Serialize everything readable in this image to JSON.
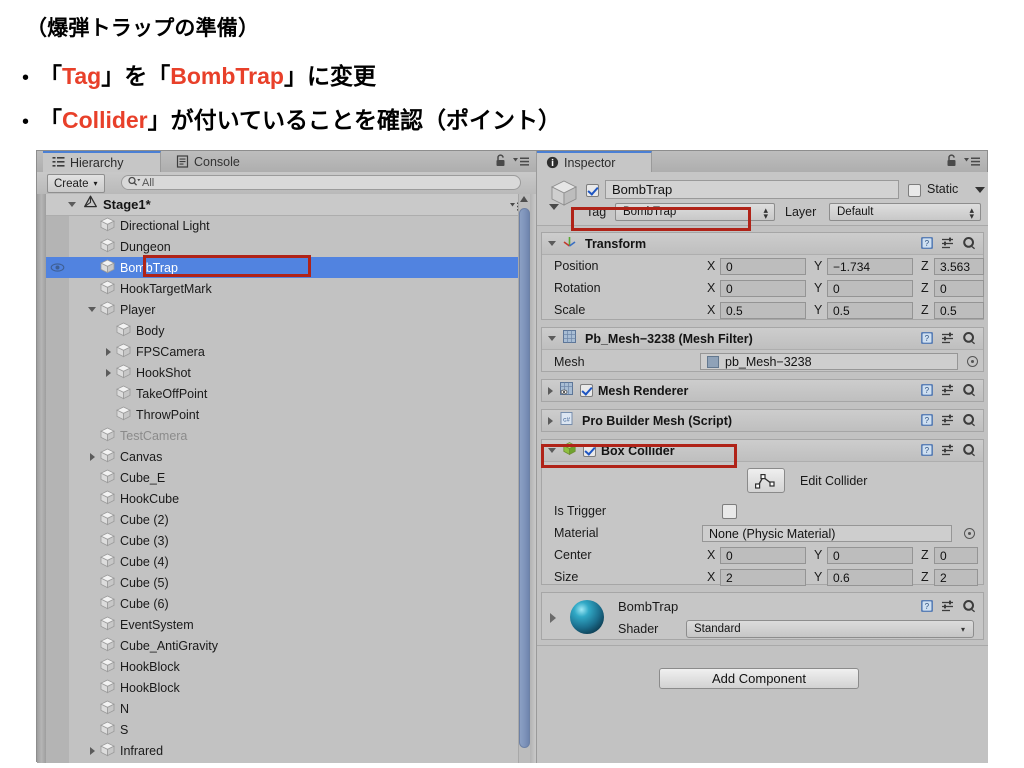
{
  "slide": {
    "title": "（爆弾トラップの準備）",
    "bullets": [
      {
        "dot": "•",
        "pre": "「",
        "em1": "Tag",
        "mid": "」を「",
        "em2": "BombTrap",
        "post": "」に変更"
      },
      {
        "dot": "•",
        "pre": "「",
        "em1": "Collider",
        "mid": "」が付いていることを確認（ポイント）",
        "em2": "",
        "post": ""
      }
    ],
    "bullet1_parts": [
      "「",
      "Tag",
      "」を「",
      "BombTrap",
      "」に変更"
    ],
    "bullet2_parts": [
      "「",
      "Collider",
      "」が付いていることを確認（ポイント）"
    ]
  },
  "hierarchy": {
    "tabs": [
      {
        "label": "Hierarchy",
        "icon": "hierarchy-list-icon",
        "active": true
      },
      {
        "label": "Console",
        "icon": "console-icon",
        "active": false
      }
    ],
    "lock_icon": "lock-icon",
    "menu_icon": "panel-menu-icon",
    "toolbar": {
      "create_label": "Create",
      "create_arrow": "▾",
      "search_value": "All",
      "search_icon": "search-icon"
    },
    "scene": {
      "name": "Stage1*",
      "icon": "unity-scene-icon",
      "expanded": true,
      "menu_icon": "scene-menu-icon"
    },
    "items": [
      {
        "label": "Directional Light",
        "depth": 1,
        "twisty": "none",
        "selected": false,
        "dim": false,
        "eye": false
      },
      {
        "label": "Dungeon",
        "depth": 1,
        "twisty": "none",
        "selected": false,
        "dim": false,
        "eye": false
      },
      {
        "label": "BombTrap",
        "depth": 1,
        "twisty": "none",
        "selected": true,
        "dim": false,
        "eye": true
      },
      {
        "label": "HookTargetMark",
        "depth": 1,
        "twisty": "none",
        "selected": false,
        "dim": false,
        "eye": false
      },
      {
        "label": "Player",
        "depth": 1,
        "twisty": "down",
        "selected": false,
        "dim": false,
        "eye": false
      },
      {
        "label": "Body",
        "depth": 2,
        "twisty": "none",
        "selected": false,
        "dim": false,
        "eye": false
      },
      {
        "label": "FPSCamera",
        "depth": 2,
        "twisty": "right",
        "selected": false,
        "dim": false,
        "eye": false
      },
      {
        "label": "HookShot",
        "depth": 2,
        "twisty": "right",
        "selected": false,
        "dim": false,
        "eye": false
      },
      {
        "label": "TakeOffPoint",
        "depth": 2,
        "twisty": "none",
        "selected": false,
        "dim": false,
        "eye": false
      },
      {
        "label": "ThrowPoint",
        "depth": 2,
        "twisty": "none",
        "selected": false,
        "dim": false,
        "eye": false
      },
      {
        "label": "TestCamera",
        "depth": 1,
        "twisty": "none",
        "selected": false,
        "dim": true,
        "eye": false
      },
      {
        "label": "Canvas",
        "depth": 1,
        "twisty": "right",
        "selected": false,
        "dim": false,
        "eye": false
      },
      {
        "label": "Cube_E",
        "depth": 1,
        "twisty": "none",
        "selected": false,
        "dim": false,
        "eye": false
      },
      {
        "label": "HookCube",
        "depth": 1,
        "twisty": "none",
        "selected": false,
        "dim": false,
        "eye": false
      },
      {
        "label": "Cube (2)",
        "depth": 1,
        "twisty": "none",
        "selected": false,
        "dim": false,
        "eye": false
      },
      {
        "label": "Cube (3)",
        "depth": 1,
        "twisty": "none",
        "selected": false,
        "dim": false,
        "eye": false
      },
      {
        "label": "Cube (4)",
        "depth": 1,
        "twisty": "none",
        "selected": false,
        "dim": false,
        "eye": false
      },
      {
        "label": "Cube (5)",
        "depth": 1,
        "twisty": "none",
        "selected": false,
        "dim": false,
        "eye": false
      },
      {
        "label": "Cube (6)",
        "depth": 1,
        "twisty": "none",
        "selected": false,
        "dim": false,
        "eye": false
      },
      {
        "label": "EventSystem",
        "depth": 1,
        "twisty": "none",
        "selected": false,
        "dim": false,
        "eye": false
      },
      {
        "label": "Cube_AntiGravity",
        "depth": 1,
        "twisty": "none",
        "selected": false,
        "dim": false,
        "eye": false
      },
      {
        "label": "HookBlock",
        "depth": 1,
        "twisty": "none",
        "selected": false,
        "dim": false,
        "eye": false
      },
      {
        "label": "HookBlock",
        "depth": 1,
        "twisty": "none",
        "selected": false,
        "dim": false,
        "eye": false
      },
      {
        "label": "N",
        "depth": 1,
        "twisty": "none",
        "selected": false,
        "dim": false,
        "eye": false
      },
      {
        "label": "S",
        "depth": 1,
        "twisty": "none",
        "selected": false,
        "dim": false,
        "eye": false
      },
      {
        "label": "Infrared",
        "depth": 1,
        "twisty": "right",
        "selected": false,
        "dim": false,
        "eye": false
      }
    ]
  },
  "inspector": {
    "tab_label": "Inspector",
    "tab_icon": "info-icon",
    "lock_icon": "lock-icon",
    "menu_icon": "panel-menu-icon",
    "object": {
      "enabled": true,
      "name": "BombTrap",
      "static_label": "Static",
      "static_checked": false,
      "tag_label": "Tag",
      "tag_value": "BombTrap",
      "layer_label": "Layer",
      "layer_value": "Default"
    },
    "transform": {
      "title": "Transform",
      "icon": "transform-axis-icon",
      "expanded": true,
      "rows": [
        {
          "label": "Position",
          "x": "0",
          "y": "−1.734",
          "z": "3.563"
        },
        {
          "label": "Rotation",
          "x": "0",
          "y": "0",
          "z": "0"
        },
        {
          "label": "Scale",
          "x": "0.5",
          "y": "0.5",
          "z": "0.5"
        }
      ],
      "axis_labels": [
        "X",
        "Y",
        "Z"
      ]
    },
    "mesh_filter": {
      "title": "Pb_Mesh−3238 (Mesh Filter)",
      "icon": "mesh-filter-icon",
      "expanded": true,
      "mesh_label": "Mesh",
      "mesh_value": "pb_Mesh−3238"
    },
    "mesh_renderer": {
      "title": "Mesh Renderer",
      "icon": "mesh-renderer-icon",
      "expanded": false,
      "enabled": true
    },
    "pro_builder": {
      "title": "Pro Builder Mesh (Script)",
      "icon": "csharp-script-icon",
      "expanded": false
    },
    "box_collider": {
      "title": "Box Collider",
      "icon": "box-collider-icon",
      "expanded": true,
      "enabled": true,
      "edit_collider_label": "Edit Collider",
      "edit_collider_icon": "edit-collider-icon",
      "is_trigger_label": "Is Trigger",
      "is_trigger_checked": false,
      "material_label": "Material",
      "material_value": "None (Physic Material)",
      "center_label": "Center",
      "center": {
        "x": "0",
        "y": "0",
        "z": "0"
      },
      "size_label": "Size",
      "size": {
        "x": "2",
        "y": "0.6",
        "z": "2"
      }
    },
    "material": {
      "name": "BombTrap",
      "preview_icon": "material-sphere-preview",
      "shader_label": "Shader",
      "shader_value": "Standard"
    },
    "add_component_label": "Add Component",
    "header_icons": [
      "help-icon",
      "preset-icon",
      "gear-icon"
    ]
  },
  "colors": {
    "accent_red": "#e8402a",
    "annotation_red": "#b02318",
    "selection_blue": "#5183e0",
    "panel_bg": "#c2c2c2",
    "component_bg": "#c6c6c6"
  }
}
